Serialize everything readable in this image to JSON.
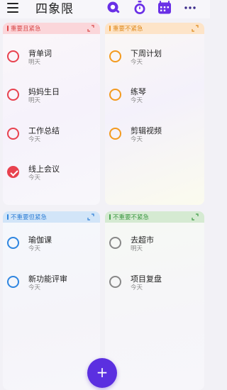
{
  "header": {
    "title": "四象限",
    "icons": [
      "menu-icon",
      "search-icon",
      "timer-icon",
      "calendar-icon",
      "more-icon"
    ]
  },
  "colors": {
    "accent": "#5b2fe0",
    "urgent_important": "#e04848",
    "important_not_urgent": "#f09a2a",
    "urgent_not_important": "#2f86e0",
    "not_urgent_not_important": "#4aa54f"
  },
  "quadrants": [
    {
      "label": "重要且紧急",
      "tasks": [
        {
          "name": "背单词",
          "date": "明天",
          "done": false
        },
        {
          "name": "妈妈生日",
          "date": "明天",
          "done": false
        },
        {
          "name": "工作总结",
          "date": "今天",
          "done": false
        },
        {
          "name": "线上会议",
          "date": "今天",
          "done": true
        }
      ]
    },
    {
      "label": "重要不紧急",
      "tasks": [
        {
          "name": "下周计划",
          "date": "今天",
          "done": false
        },
        {
          "name": "练琴",
          "date": "今天",
          "done": false
        },
        {
          "name": "剪辑视频",
          "date": "今天",
          "done": false
        }
      ]
    },
    {
      "label": "不重要但紧急",
      "tasks": [
        {
          "name": "瑜伽课",
          "date": "今天",
          "done": false
        },
        {
          "name": "新功能评审",
          "date": "今天",
          "done": false
        }
      ]
    },
    {
      "label": "不重要不紧急",
      "tasks": [
        {
          "name": "去超市",
          "date": "明天",
          "done": false
        },
        {
          "name": "项目复盘",
          "date": "今天",
          "done": false
        }
      ]
    }
  ],
  "fab": {
    "label": "+"
  }
}
